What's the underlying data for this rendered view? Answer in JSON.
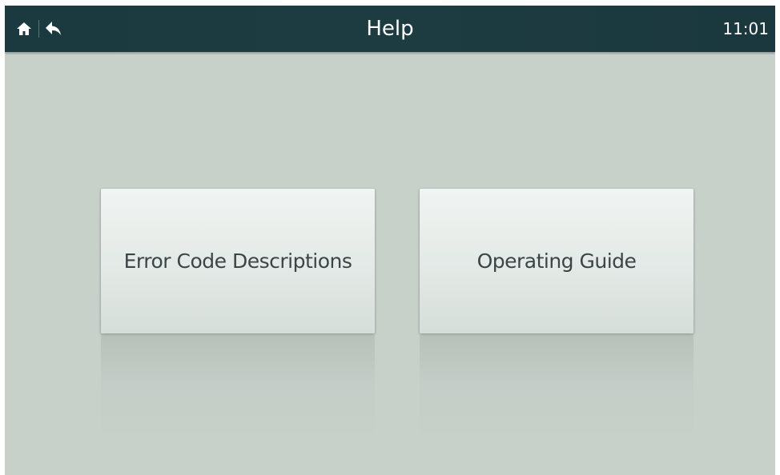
{
  "header": {
    "title": "Help",
    "time": "11:01",
    "icons": {
      "home": "home-icon",
      "back": "back-icon"
    }
  },
  "menu": {
    "items": [
      {
        "label": "Error Code Descriptions"
      },
      {
        "label": "Operating Guide"
      }
    ]
  },
  "colors": {
    "topbar": "#1d3c42",
    "background": "#c8d0ca",
    "button_face": "#e3e9e6",
    "button_text": "#3c4446"
  }
}
